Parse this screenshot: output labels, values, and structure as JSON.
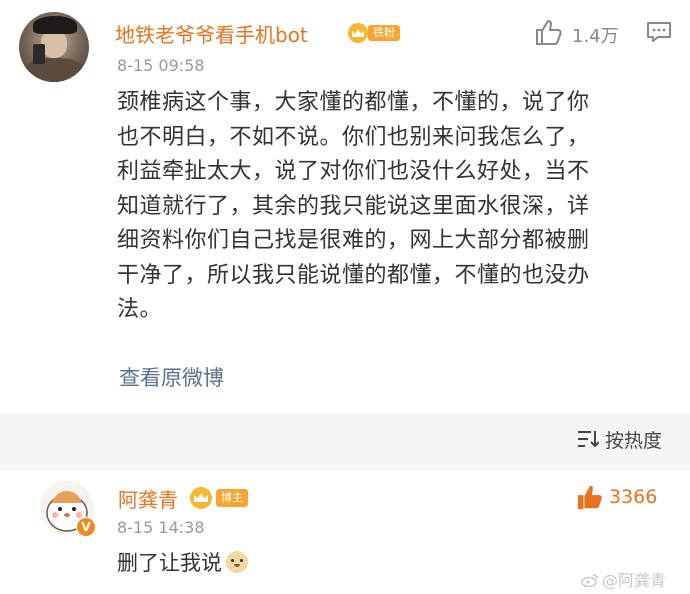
{
  "comment": {
    "author": "地铁老爷爷看手机bot",
    "badge": "铁粉",
    "like_count": "1.4万",
    "timestamp": "8-15 09:58",
    "body_lines": [
      "颈椎病这个事，大家懂的都懂，不懂的，说了你",
      "也不明白，不如不说。你们也别来问我怎么了，",
      "利益牵扯太大，说了对你们也没什么好处，当不",
      "知道就行了，其余的我只能说这里面水很深，详",
      "细资料你们自己找是很难的，网上大部分都被删",
      "干净了，所以我只能说懂的都懂，不懂的也没办",
      "法。"
    ],
    "view_original": "查看原微博"
  },
  "sort": {
    "label": "按热度"
  },
  "reply": {
    "author": "阿龚青",
    "badge": "博主",
    "verified": "V",
    "like_count": "3366",
    "timestamp": "8-15 14:38",
    "text": "删了让我说"
  },
  "watermark": "@阿龚青",
  "colors": {
    "name": "#e8731f",
    "link": "#5a7191",
    "meta": "#9a9a9a",
    "badge": "#f7a531"
  }
}
